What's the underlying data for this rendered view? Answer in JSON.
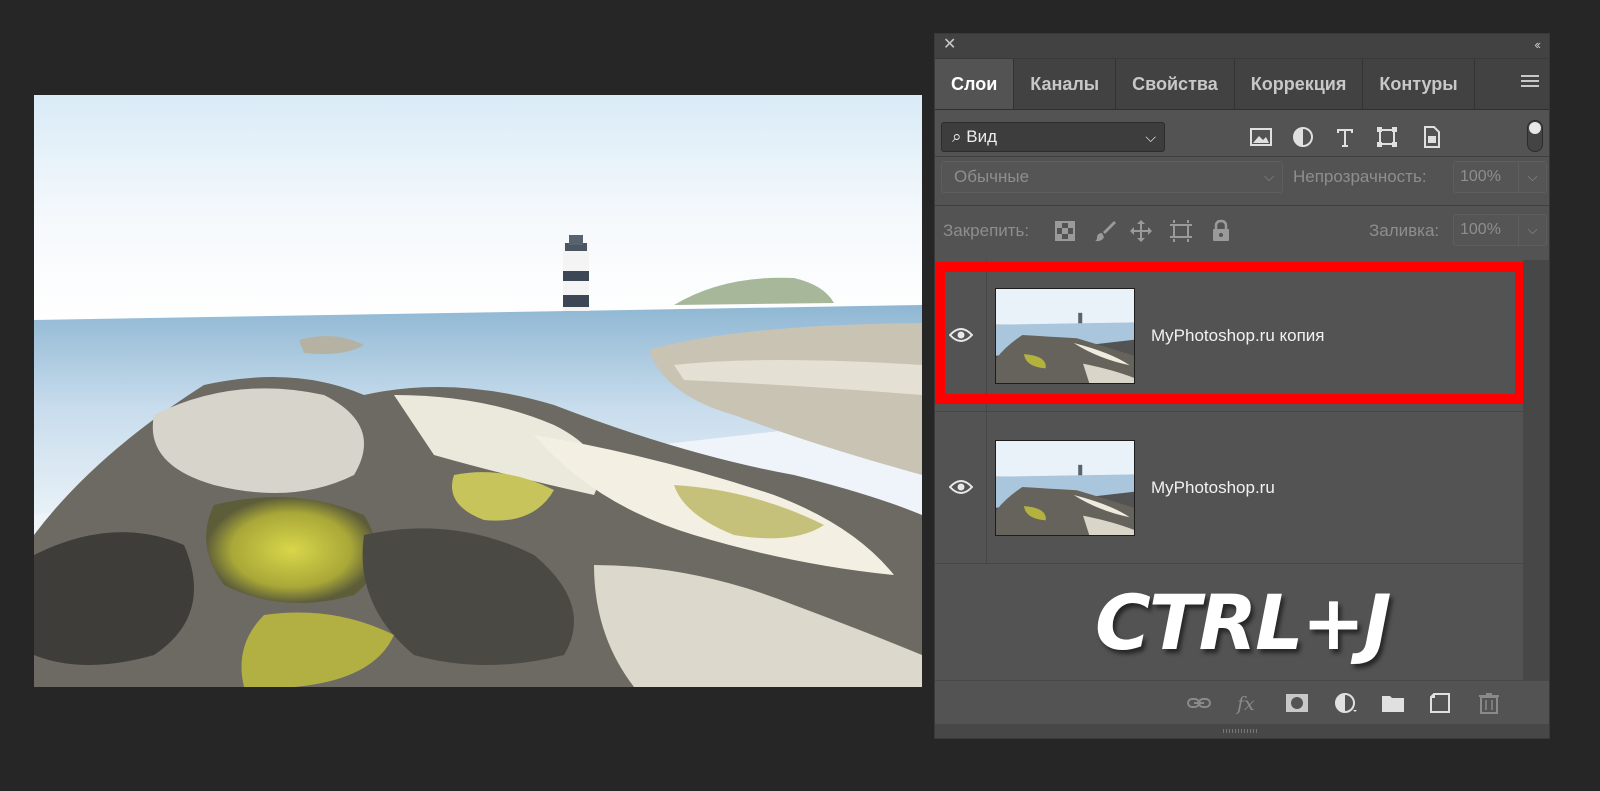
{
  "panel": {
    "tabs": [
      {
        "label": "Слои",
        "active": true
      },
      {
        "label": "Каналы",
        "active": false
      },
      {
        "label": "Свойства",
        "active": false
      },
      {
        "label": "Коррекция",
        "active": false
      },
      {
        "label": "Контуры",
        "active": false
      }
    ],
    "filter": {
      "label": "Вид"
    },
    "blend": {
      "mode": "Обычные",
      "opacity_label": "Непрозрачность:",
      "opacity_value": "100%"
    },
    "lock": {
      "label": "Закрепить:",
      "fill_label": "Заливка:",
      "fill_value": "100%"
    },
    "layers": [
      {
        "name": "MyPhotoshop.ru копия",
        "visible": true,
        "highlighted": true
      },
      {
        "name": "MyPhotoshop.ru",
        "visible": true,
        "highlighted": false
      }
    ],
    "shortcut": "CTRL+J",
    "highlight_color": "#ff0000"
  },
  "icons": {
    "close": "close-icon",
    "collapse": "double-chevron-icon",
    "menu": "hamburger-menu-icon"
  }
}
